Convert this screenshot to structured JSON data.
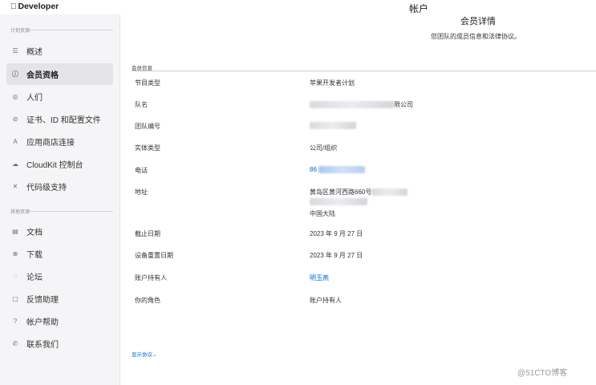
{
  "brand": {
    "apple_glyph": "",
    "name": "Developer"
  },
  "window_title": "帐户",
  "sidebar": {
    "section_plan": "计划资源",
    "plan_items": [
      {
        "label": "概述",
        "icon": "list-icon"
      },
      {
        "label": "会员资格",
        "icon": "info-circle-icon",
        "active": true
      },
      {
        "label": "人们",
        "icon": "person-circle-icon"
      },
      {
        "label": "证书、ID 和配置文件",
        "icon": "checkmark-circle-icon"
      },
      {
        "label": "应用商店连接",
        "icon": "app-store-icon"
      },
      {
        "label": "CloudKit 控制台",
        "icon": "cloud-icon"
      },
      {
        "label": "代码级支持",
        "icon": "tools-icon"
      }
    ],
    "section_other": "其他资源",
    "other_items": [
      {
        "label": "文档",
        "icon": "document-icon"
      },
      {
        "label": "下载",
        "icon": "download-circle-icon"
      },
      {
        "label": "论坛",
        "icon": "speech-bubble-icon"
      },
      {
        "label": "反馈助理",
        "icon": "feedback-icon"
      },
      {
        "label": "帐户帮助",
        "icon": "question-circle-icon"
      },
      {
        "label": "联系我们",
        "icon": "phone-icon"
      }
    ]
  },
  "main": {
    "heading": "会员详情",
    "subtitle": "您团队的成员信息和法律协议。",
    "info_section": "会员信息",
    "rows": {
      "program_type": {
        "label": "节目类型",
        "value": "苹果开发者计划"
      },
      "team_name": {
        "label": "队名",
        "value_suffix": "限公司"
      },
      "team_id": {
        "label": "团队编号"
      },
      "entity_type": {
        "label": "实体类型",
        "value": "公司/组织"
      },
      "phone": {
        "label": "电话",
        "value_prefix": "86"
      },
      "address": {
        "label": "地址",
        "line1": "黄岛区黄河西路660号",
        "line3": "中国大陆"
      },
      "expiry": {
        "label": "截止日期",
        "value": "2023 年 9 月 27 日"
      },
      "device_reset": {
        "label": "设备重置日期",
        "value": "2023 年 9 月 27 日"
      },
      "holder": {
        "label": "账户持有人",
        "value": "明玉燕"
      },
      "role": {
        "label": "你的角色",
        "value": "账户持有人"
      }
    },
    "show_agreement": "显示协议",
    "show_agreement_chevron": "⌄"
  },
  "watermark": "@51CTO博客",
  "colors": {
    "link": "#0066cc",
    "sidebar_bg": "#f5f5f7",
    "active_bg": "#e3e3e8"
  }
}
